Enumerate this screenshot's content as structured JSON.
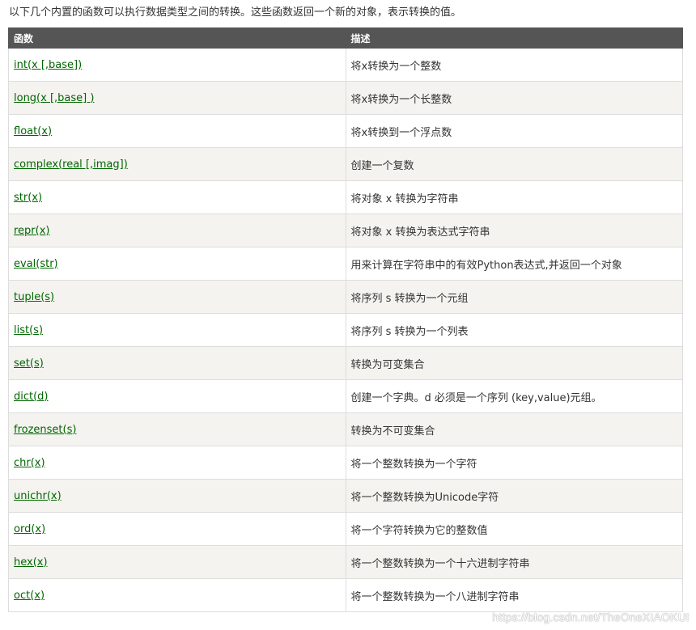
{
  "intro_text": "以下几个内置的函数可以执行数据类型之间的转换。这些函数返回一个新的对象，表示转换的值。",
  "table": {
    "headers": [
      "函数",
      "描述"
    ],
    "rows": [
      {
        "func": "int(x [,base])",
        "desc": "将x转换为一个整数"
      },
      {
        "func": "long(x [,base] )",
        "desc": "将x转换为一个长整数"
      },
      {
        "func": "float(x)",
        "desc": "将x转换到一个浮点数"
      },
      {
        "func": "complex(real [,imag])",
        "desc": "创建一个复数"
      },
      {
        "func": "str(x)",
        "desc": "将对象 x 转换为字符串"
      },
      {
        "func": "repr(x)",
        "desc": "将对象 x 转换为表达式字符串"
      },
      {
        "func": "eval(str)",
        "desc": "用来计算在字符串中的有效Python表达式,并返回一个对象"
      },
      {
        "func": "tuple(s)",
        "desc": "将序列 s 转换为一个元组"
      },
      {
        "func": "list(s)",
        "desc": "将序列 s 转换为一个列表"
      },
      {
        "func": "set(s)",
        "desc": "转换为可变集合"
      },
      {
        "func": "dict(d)",
        "desc": "创建一个字典。d 必须是一个序列 (key,value)元组。"
      },
      {
        "func": "frozenset(s)",
        "desc": "转换为不可变集合"
      },
      {
        "func": "chr(x)",
        "desc": "将一个整数转换为一个字符"
      },
      {
        "func": "unichr(x)",
        "desc": "将一个整数转换为Unicode字符"
      },
      {
        "func": "ord(x)",
        "desc": "将一个字符转换为它的整数值"
      },
      {
        "func": "hex(x)",
        "desc": "将一个整数转换为一个十六进制字符串"
      },
      {
        "func": "oct(x)",
        "desc": "将一个整数转换为一个八进制字符串"
      }
    ]
  },
  "watermark": "https://blog.csdn.net/TheOneXIAOKUI",
  "colors": {
    "header_bg": "#555555",
    "header_text": "#ffffff",
    "link": "#006600",
    "row_alt_bg": "#f4f3ef",
    "border": "#dddddd"
  }
}
